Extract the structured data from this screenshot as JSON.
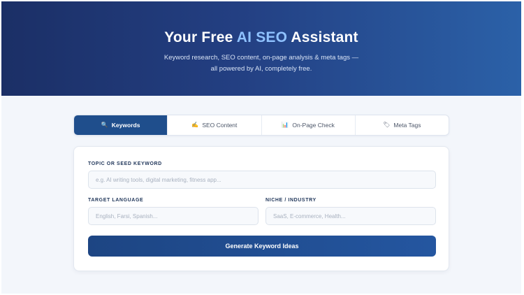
{
  "hero": {
    "title_pre": "Your Free ",
    "title_accent": "AI SEO",
    "title_post": " Assistant",
    "subtitle_line1": "Keyword research, SEO content, on-page analysis & meta tags —",
    "subtitle_line2": "all powered by AI, completely free."
  },
  "tabs": [
    {
      "label": "Keywords",
      "icon": "search-icon",
      "glyph": "🔍",
      "active": true
    },
    {
      "label": "SEO Content",
      "icon": "pencil-icon",
      "glyph": "✍",
      "active": false
    },
    {
      "label": "On-Page Check",
      "icon": "chart-icon",
      "glyph": "📊",
      "active": false
    },
    {
      "label": "Meta Tags",
      "icon": "tag-icon",
      "glyph": "🏷",
      "active": false
    }
  ],
  "form": {
    "topic_label": "TOPIC OR SEED KEYWORD",
    "topic_placeholder": "e.g. AI writing tools, digital marketing, fitness app...",
    "topic_value": "",
    "language_label": "TARGET LANGUAGE",
    "language_placeholder": "English, Farsi, Spanish...",
    "language_value": "",
    "niche_label": "NICHE / INDUSTRY",
    "niche_placeholder": "SaaS, E-commerce, Health...",
    "niche_value": "",
    "submit_label": "Generate Keyword Ideas"
  },
  "colors": {
    "hero_start": "#1b2f66",
    "hero_end": "#2b61a8",
    "accent_text": "#8fc2ff",
    "primary": "#1f4e8c"
  }
}
